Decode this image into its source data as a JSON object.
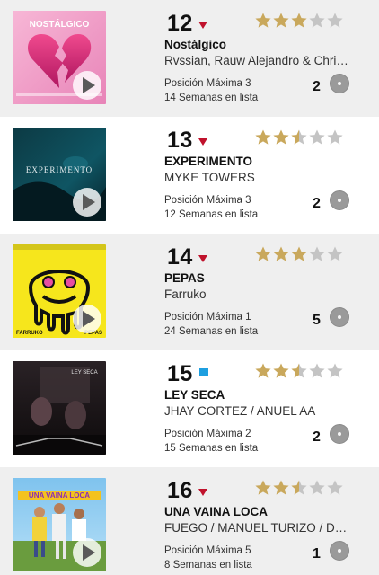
{
  "colors": {
    "star_filled": "#c9a85c",
    "star_empty": "#c4c4c4",
    "trend_down": "#c0122c",
    "trend_new": "#1e9fe0"
  },
  "entries": [
    {
      "rank": "12",
      "trend": "down",
      "stars": 3,
      "title": "Nostálgico",
      "artist": "Rvssian, Rauw Alejandro & Chris Brown",
      "peak": "Posición Máxima 3",
      "weeks": "14 Semanas en lista",
      "discs": "2",
      "cover_text": "NOSTÁLGICO",
      "cover_icon": "broken-heart-icon"
    },
    {
      "rank": "13",
      "trend": "down",
      "stars": 2.5,
      "title": "EXPERIMENTO",
      "artist": "MYKE TOWERS",
      "peak": "Posición Máxima 3",
      "weeks": "12 Semanas en lista",
      "discs": "2",
      "cover_text": "EXPERIMENTO",
      "cover_icon": "night-scene-icon"
    },
    {
      "rank": "14",
      "trend": "down",
      "stars": 3,
      "title": "PEPAS",
      "artist": "Farruko",
      "peak": "Posición Máxima 1",
      "weeks": "24 Semanas en lista",
      "discs": "5",
      "cover_text_left": "FARRUKO",
      "cover_text_right": "PEPAS",
      "cover_icon": "melting-smiley-icon"
    },
    {
      "rank": "15",
      "trend": "new",
      "stars": 2.5,
      "title": "LEY SECA",
      "artist": "JHAY CORTEZ / ANUEL AA",
      "peak": "Posición Máxima 2",
      "weeks": "15 Semanas en lista",
      "discs": "2",
      "cover_text": "LEY SECA",
      "cover_icon": "dark-room-icon"
    },
    {
      "rank": "16",
      "trend": "down",
      "stars": 2.5,
      "title": "UNA VAINA LOCA",
      "artist": "FUEGO / MANUEL TURIZO / DUKI",
      "peak": "Posición Máxima 5",
      "weeks": "8 Semanas en lista",
      "discs": "1",
      "cover_text": "UNA VAINA LOCA",
      "cover_icon": "group-photo-icon"
    }
  ]
}
